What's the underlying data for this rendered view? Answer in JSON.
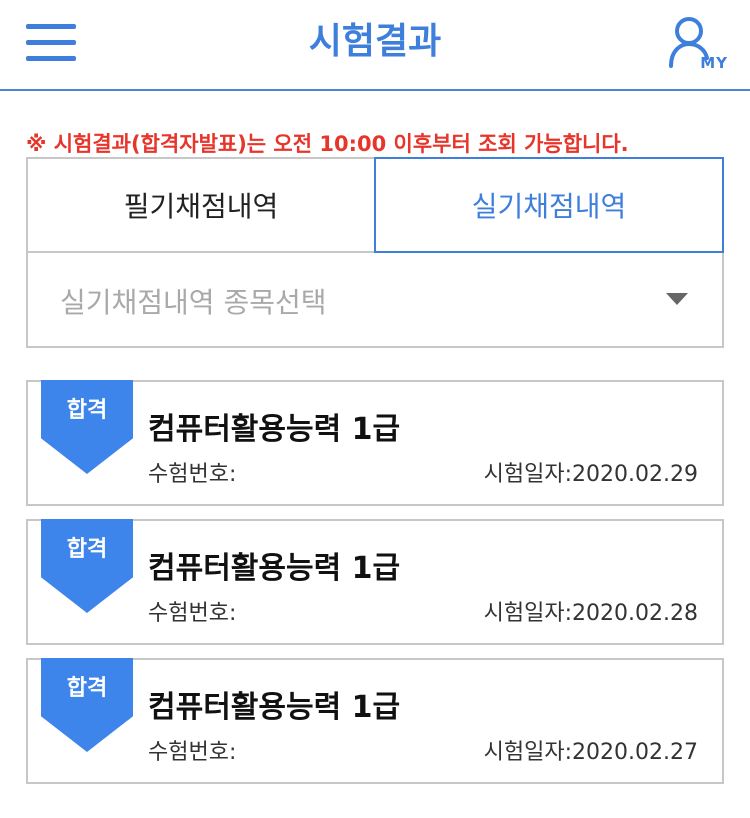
{
  "header": {
    "title": "시험결과",
    "menu_icon": "hamburger-menu-icon",
    "my_icon": "user-icon",
    "my_label": "MY"
  },
  "notice": {
    "text": "※ 시험결과(합격자발표)는 오전 10:00 이후부터 조회 가능합니다."
  },
  "tabs": [
    {
      "label": "필기채점내역",
      "active": false
    },
    {
      "label": "실기채점내역",
      "active": true
    }
  ],
  "select": {
    "placeholder": "실기채점내역 종목선택",
    "caret_icon": "caret-down-icon"
  },
  "results": [
    {
      "badge": "합격",
      "title": "컴퓨터활용능력 1급",
      "exam_no": "수험번호:",
      "exam_date": "시험일자:2020.02.29"
    },
    {
      "badge": "합격",
      "title": "컴퓨터활용능력 1급",
      "exam_no": "수험번호:",
      "exam_date": "시험일자:2020.02.28"
    },
    {
      "badge": "합격",
      "title": "컴퓨터활용능력 1급",
      "exam_no": "수험번호:",
      "exam_date": "시험일자:2020.02.27"
    }
  ],
  "colors": {
    "accent": "#3e7fdc",
    "ribbon": "#3e85eb",
    "notice": "#e8352b",
    "border": "#c7c7c7"
  }
}
